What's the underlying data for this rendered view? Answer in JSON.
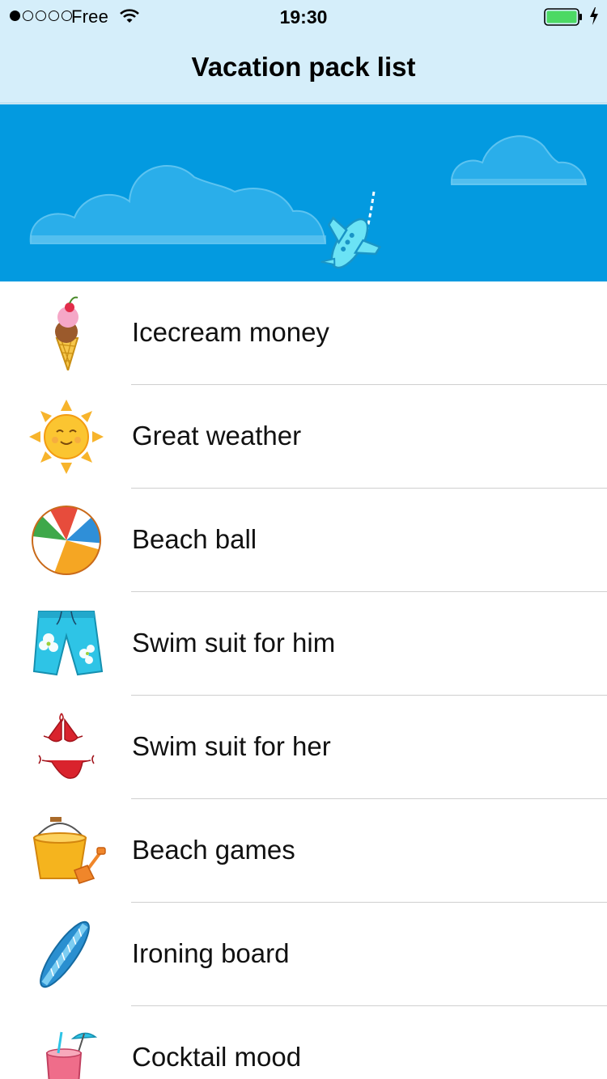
{
  "status_bar": {
    "carrier": "Free",
    "time": "19:30",
    "signal_strength": 1,
    "signal_max": 5,
    "battery_level": 1.0,
    "battery_charging": true,
    "icons": [
      "wifi-icon",
      "battery-icon",
      "charging-bolt-icon"
    ]
  },
  "nav": {
    "title": "Vacation pack list"
  },
  "banner": {
    "background_color": "#039ae0",
    "icons": [
      "cloud-icon",
      "airplane-icon"
    ]
  },
  "items": [
    {
      "label": "Icecream money",
      "icon": "ice-cream-icon"
    },
    {
      "label": "Great weather",
      "icon": "sun-icon"
    },
    {
      "label": "Beach ball",
      "icon": "beach-ball-icon"
    },
    {
      "label": "Swim suit for him",
      "icon": "swim-trunks-icon"
    },
    {
      "label": "Swim suit for her",
      "icon": "bikini-icon"
    },
    {
      "label": "Beach games",
      "icon": "bucket-and-spade-icon"
    },
    {
      "label": "Ironing board",
      "icon": "surfboard-icon"
    },
    {
      "label": "Cocktail mood",
      "icon": "cocktail-icon"
    }
  ]
}
